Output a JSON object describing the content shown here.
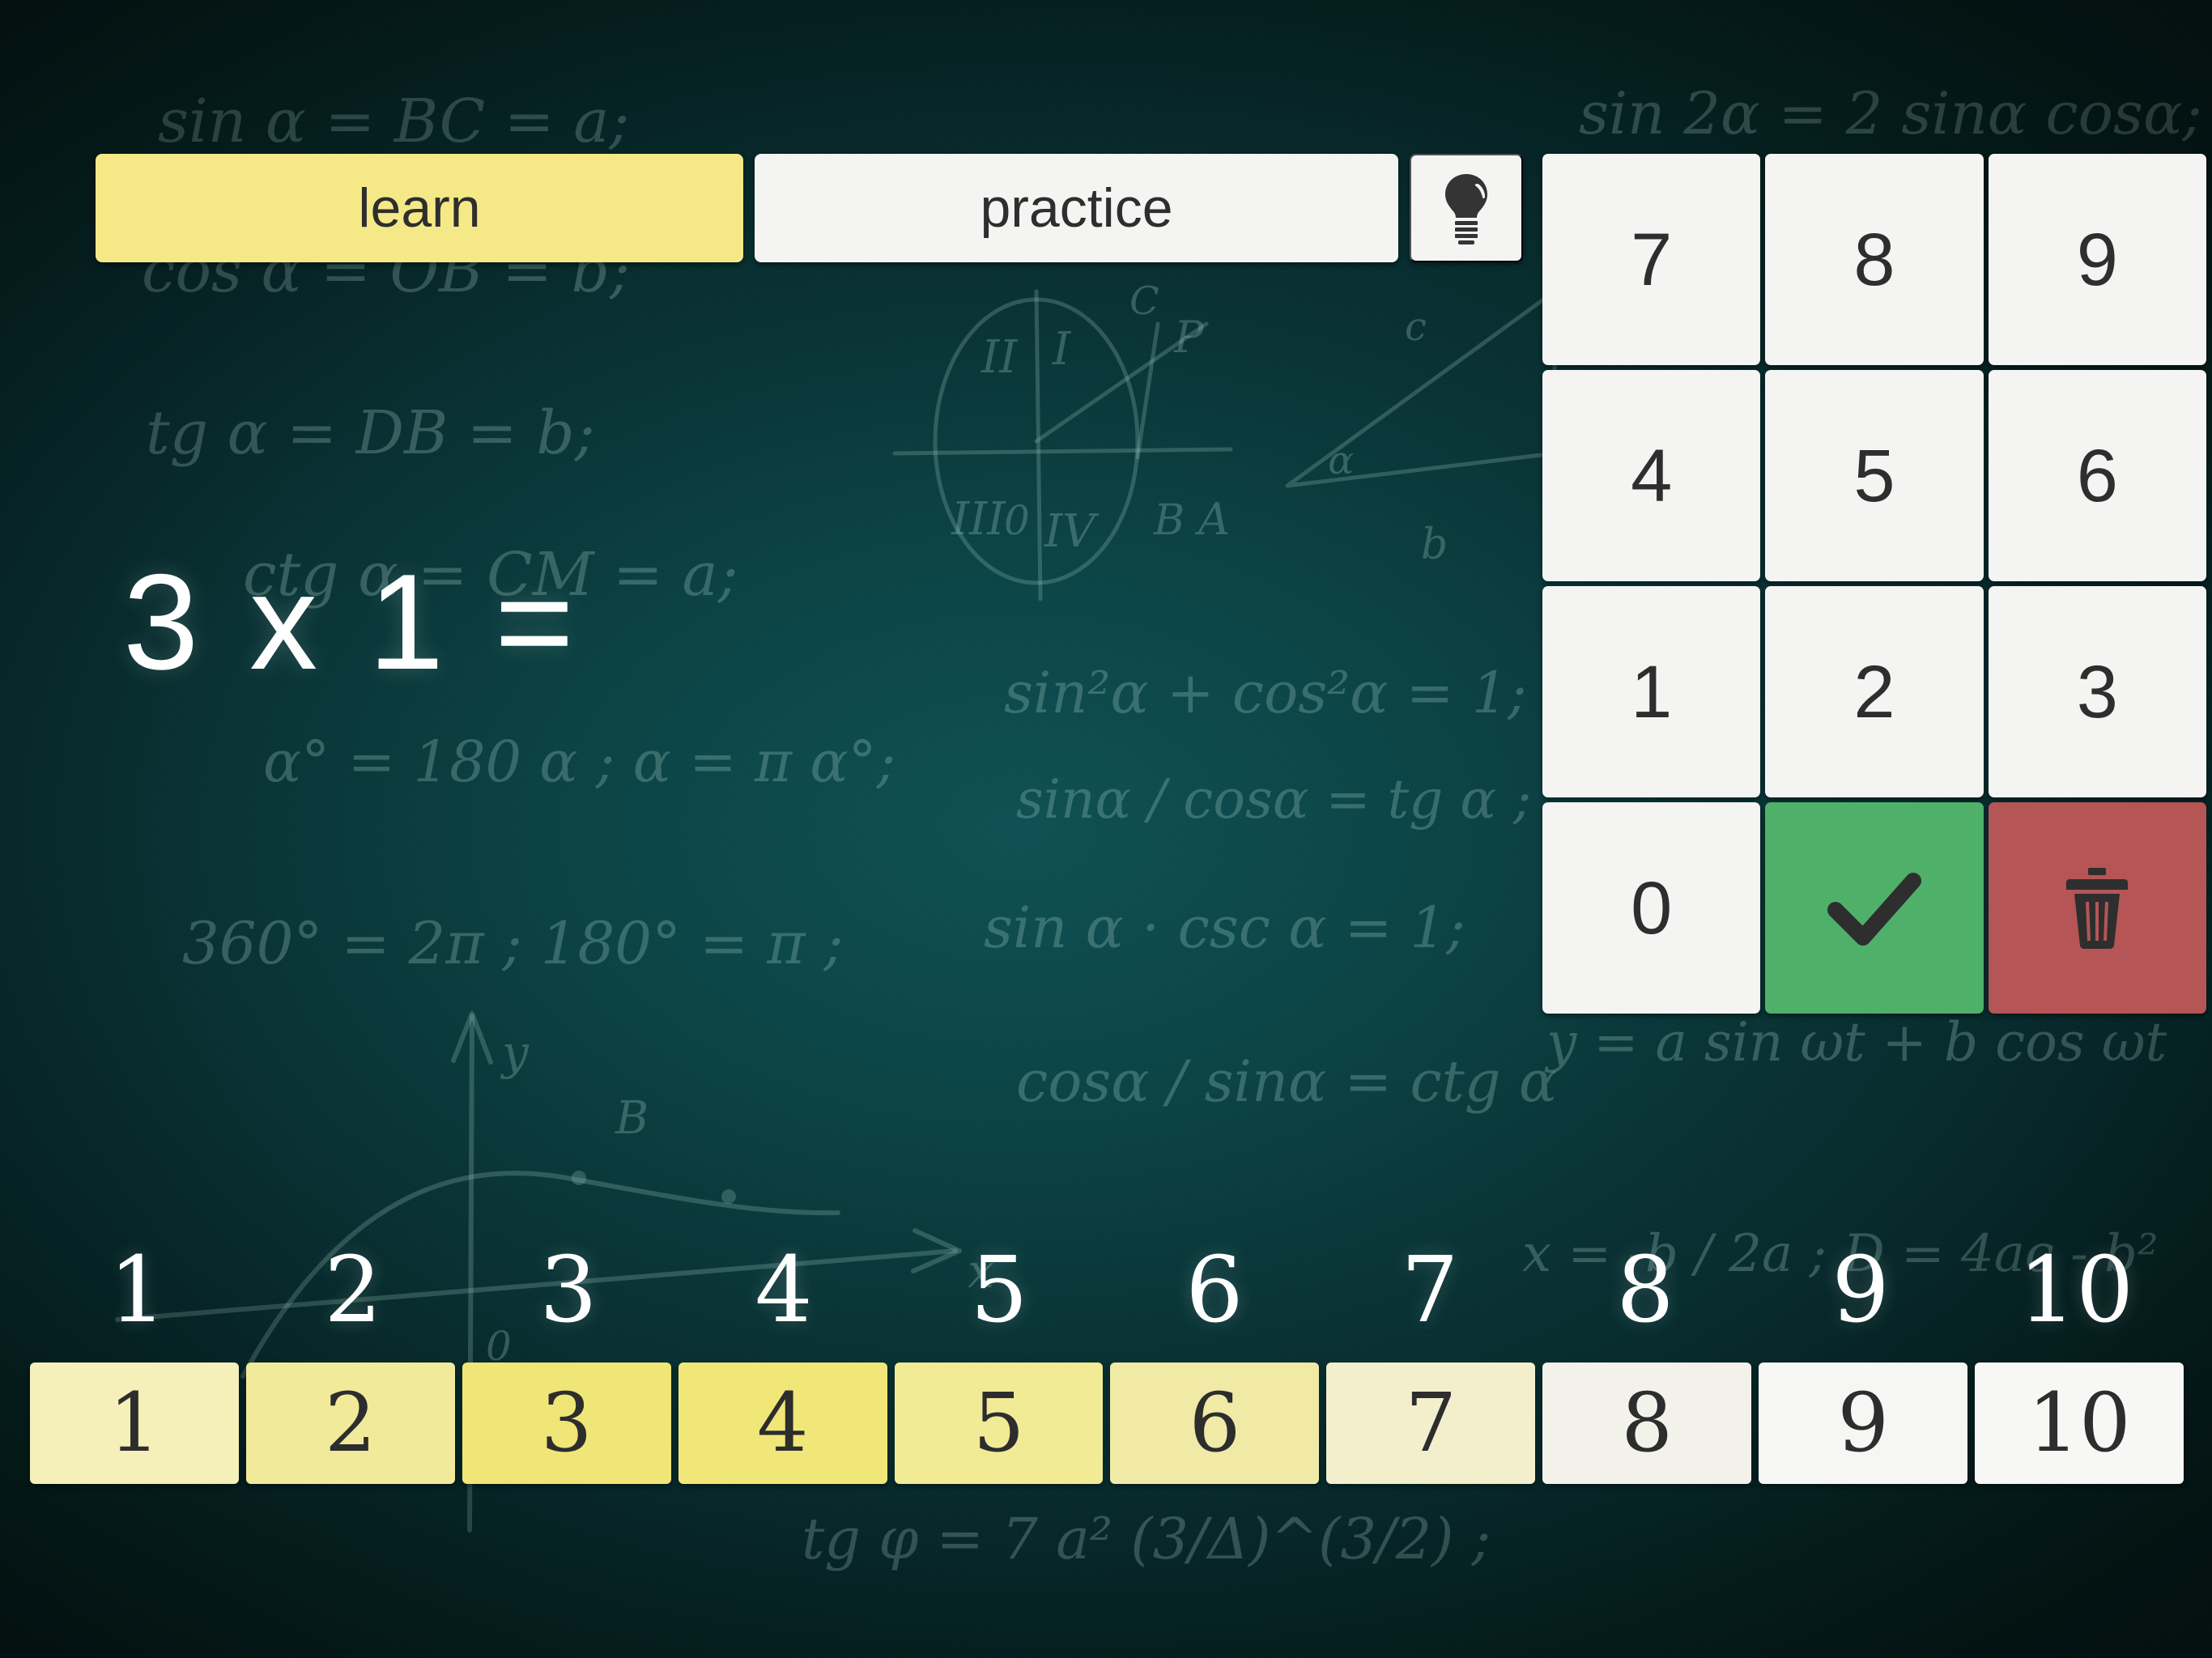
{
  "app": {
    "background_color": "#0c4345",
    "accent_yellow": "#f5e987",
    "panel_white": "#f4f4f2",
    "confirm_green": "#4fb06a",
    "delete_red": "#b55555",
    "text_dark": "#2e2e2e",
    "text_light": "#ffffff"
  },
  "tabs": {
    "learn": {
      "label": "learn",
      "selected": true
    },
    "practice": {
      "label": "practice",
      "selected": false
    },
    "hint": {
      "icon": "lightbulb-icon"
    }
  },
  "equation": {
    "text": "3 x 1 =",
    "left_operand": "3",
    "operator": "x",
    "right_operand": "1",
    "equals": "="
  },
  "keypad": {
    "keys": [
      {
        "label": "7",
        "name": "key-7",
        "kind": "digit"
      },
      {
        "label": "8",
        "name": "key-8",
        "kind": "digit"
      },
      {
        "label": "9",
        "name": "key-9",
        "kind": "digit"
      },
      {
        "label": "4",
        "name": "key-4",
        "kind": "digit"
      },
      {
        "label": "5",
        "name": "key-5",
        "kind": "digit"
      },
      {
        "label": "6",
        "name": "key-6",
        "kind": "digit"
      },
      {
        "label": "1",
        "name": "key-1",
        "kind": "digit"
      },
      {
        "label": "2",
        "name": "key-2",
        "kind": "digit"
      },
      {
        "label": "3",
        "name": "key-3",
        "kind": "digit"
      },
      {
        "label": "0",
        "name": "key-0",
        "kind": "digit"
      },
      {
        "label": "",
        "name": "confirm-button",
        "kind": "check",
        "color": "#4fb06a"
      },
      {
        "label": "",
        "name": "delete-button",
        "kind": "trash",
        "color": "#b55555"
      }
    ]
  },
  "scale": {
    "labels": [
      "1",
      "2",
      "3",
      "4",
      "5",
      "6",
      "7",
      "8",
      "9",
      "10"
    ]
  },
  "progress": {
    "cells": [
      {
        "label": "1",
        "color": "#f5efb9"
      },
      {
        "label": "2",
        "color": "#f2ea9b"
      },
      {
        "label": "3",
        "color": "#f0e577"
      },
      {
        "label": "4",
        "color": "#f1e779"
      },
      {
        "label": "5",
        "color": "#f2eb96"
      },
      {
        "label": "6",
        "color": "#f0eaa6"
      },
      {
        "label": "7",
        "color": "#f3efcd"
      },
      {
        "label": "8",
        "color": "#f2f2ea"
      },
      {
        "label": "9",
        "color": "#f6f6f4"
      },
      {
        "label": "10",
        "color": "#f7f7f5"
      }
    ]
  },
  "chalk_formulas": {
    "row1": "sin α = BC = a;",
    "row2": "cos α = OB = b;",
    "row3": "tg α = DB = b;",
    "row4": "ctg α = CM = a;",
    "row5": "α° = 180 α ; α = π α°;",
    "row6": "360° = 2π ; 180° = π ;",
    "row7": "sin²α + cos²α = 1;",
    "row8": "sinα / cosα = tg α ;",
    "row9": "sin α · csc α = 1;",
    "row10": "cosα / sinα = ctg α",
    "row11": "sin 2α = 2 sinα cosα;",
    "row12": "y = a sin ωt + b cos ωt",
    "row13": "x = -b / 2a ; D = 4ac - b²",
    "row14": "tg φ = 7 a² (3/Δ)^(3/2) ;",
    "circle_labels": [
      "I",
      "II",
      "III",
      "IV",
      "0",
      "A",
      "B",
      "C",
      "P",
      "α"
    ]
  }
}
